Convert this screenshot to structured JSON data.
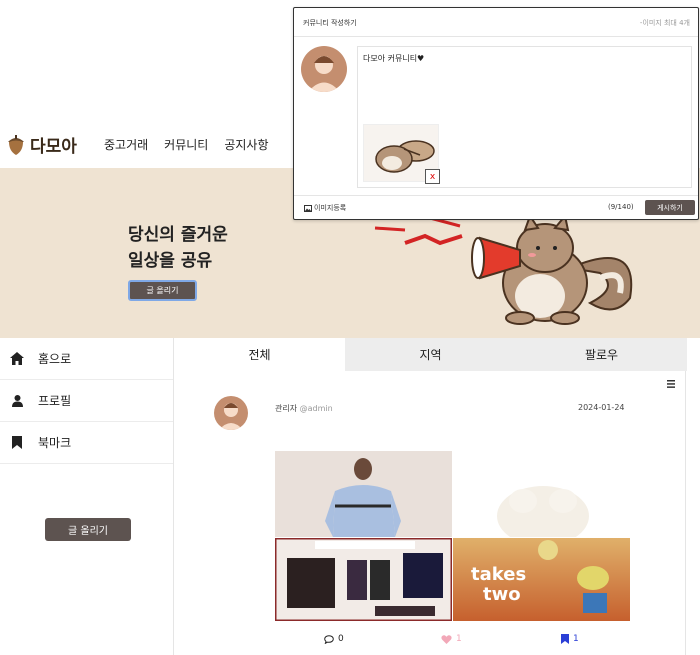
{
  "header": {
    "logo_text": "다모아",
    "nav": [
      "중고거래",
      "커뮤니티",
      "공지사항"
    ]
  },
  "hero": {
    "line1": "당신의 즐거운",
    "line2": "일상을 공유",
    "button": "글 올리기"
  },
  "sidebar": {
    "items": [
      {
        "label": "홈으로",
        "icon": "home-icon"
      },
      {
        "label": "프로필",
        "icon": "user-icon"
      },
      {
        "label": "북마크",
        "icon": "bookmark-icon"
      }
    ],
    "button": "글 올리기"
  },
  "feed": {
    "tabs": [
      "전체",
      "지역",
      "팔로우"
    ],
    "post": {
      "author": "관리자",
      "handle": "@admin",
      "date": "2024-01-24",
      "comments": "0",
      "likes": "1",
      "bookmarks": "1"
    }
  },
  "modal": {
    "title": "커뮤니티 작성하기",
    "hint": "-이미지 최대 4개",
    "text": "다모아 커뮤니티♥",
    "remove_image": "x",
    "image_upload": "이미지등록",
    "char_count": "(9/140)",
    "submit": "게시하기"
  },
  "colors": {
    "accent": "#5d5350",
    "hero_bg": "#efe3d2",
    "like": "#f2a8b8",
    "bookmark": "#2b3fd6"
  }
}
